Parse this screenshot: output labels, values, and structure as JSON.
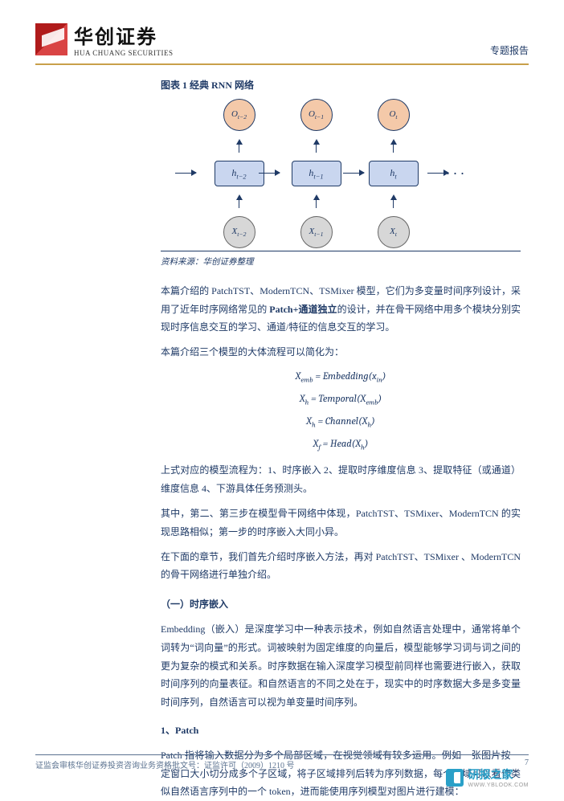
{
  "header": {
    "company_cn": "华创证券",
    "company_en": "HUA CHUANG SECURITIES",
    "report_type": "专题报告"
  },
  "figure": {
    "title": "图表 1  经典 RNN 网络",
    "cells": {
      "o0": "O",
      "o0_sub": "t−2",
      "o1": "O",
      "o1_sub": "t−1",
      "o2": "O",
      "o2_sub": "t",
      "h0": "h",
      "h0_sub": "t−2",
      "h1": "h",
      "h1_sub": "t−1",
      "h2": "h",
      "h2_sub": "t",
      "x0": "X",
      "x0_sub": "t−2",
      "x1": "X",
      "x1_sub": "t−1",
      "x2": "X",
      "x2_sub": "t"
    },
    "dots": "···",
    "source": "资料来源：华创证券整理"
  },
  "body": {
    "p1a": "本篇介绍的 PatchTST、ModernTCN、TSMixer 模型，它们为多变量时间序列设计，采用了近年时序网络常见的 ",
    "p1b": "Patch+通道独立",
    "p1c": "的设计，并在骨干网络中用多个模块分别实现时序信息交互的学习、通道/特征的信息交互的学习。",
    "p2": "本篇介绍三个模型的大体流程可以简化为：",
    "f1": "X_emb = Embedding(x_in)",
    "f2": "X_h = Temporal(X_emb)",
    "f3": "X_h = Channel(X_h)",
    "f4": "X_f = Head(X_h)",
    "p3": "上式对应的模型流程为：1、时序嵌入 2、提取时序维度信息 3、提取特征（或通道）维度信息 4、下游具体任务预测头。",
    "p4": "其中，第二、第三步在模型骨干网络中体现，PatchTST、TSMixer、ModernTCN 的实现思路相似；第一步的时序嵌入大同小异。",
    "p5": "在下面的章节，我们首先介绍时序嵌入方法，再对 PatchTST、TSMixer 、ModernTCN 的骨干网络进行单独介绍。",
    "sec1": "（一）时序嵌入",
    "p6": "Embedding（嵌入）是深度学习中一种表示技术，例如自然语言处理中，通常将单个词转为“词向量”的形式。词被映射为固定维度的向量后，模型能够学习词与词之间的更为复杂的模式和关系。时序数据在输入深度学习模型前同样也需要进行嵌入，获取时间序列的向量表征。和自然语言的不同之处在于，现实中的时序数据大多是多变量时间序列，自然语言可以视为单变量时间序列。",
    "sub1": "1、Patch",
    "p7": "Patch 指将输入数据分为多个局部区域，在视觉领域有较多运用。例如一张图片按一定窗口大小切分成多个子区域，将子区域排列后转为序列数据，每个区域可以看作类似自然语言序列中的一个 token，进而能使用序列模型对图片进行建模："
  },
  "footer": {
    "left": "证监会审核华创证券投资咨询业务资格批文号：证监许可（2009）1210 号",
    "right": "7"
  },
  "watermark": {
    "cn": "研报之家",
    "en": "WWW.YBLOOK.COM"
  },
  "chart_data": {
    "type": "diagram",
    "description": "Classic RNN unrolled over three time steps t-2, t-1, t. Input X feeds hidden state h which outputs O; hidden states connect left-to-right.",
    "nodes": [
      {
        "id": "X_t-2",
        "type": "input"
      },
      {
        "id": "X_t-1",
        "type": "input"
      },
      {
        "id": "X_t",
        "type": "input"
      },
      {
        "id": "h_t-2",
        "type": "hidden"
      },
      {
        "id": "h_t-1",
        "type": "hidden"
      },
      {
        "id": "h_t",
        "type": "hidden"
      },
      {
        "id": "O_t-2",
        "type": "output"
      },
      {
        "id": "O_t-1",
        "type": "output"
      },
      {
        "id": "O_t",
        "type": "output"
      }
    ],
    "edges": [
      [
        "X_t-2",
        "h_t-2"
      ],
      [
        "X_t-1",
        "h_t-1"
      ],
      [
        "X_t",
        "h_t"
      ],
      [
        "h_t-2",
        "O_t-2"
      ],
      [
        "h_t-1",
        "O_t-1"
      ],
      [
        "h_t",
        "O_t"
      ],
      [
        "h_t-2",
        "h_t-1"
      ],
      [
        "h_t-1",
        "h_t"
      ]
    ]
  }
}
